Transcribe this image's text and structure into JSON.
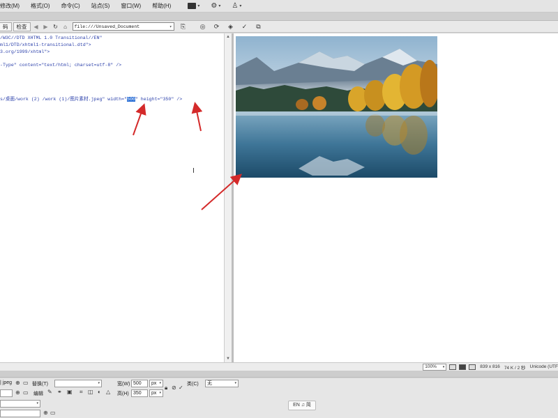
{
  "menubar": {
    "items": [
      "修改(M)",
      "格式(O)",
      "命令(C)",
      "站点(S)",
      "窗口(W)",
      "帮助(H)"
    ],
    "tools": [
      {
        "icon": "layout-icon"
      },
      {
        "icon": "gear-icon"
      },
      {
        "icon": "user-icon"
      }
    ]
  },
  "doctoolbar": {
    "tab_code_partial": "码",
    "tab_inspect": "检查",
    "address": "file:///Unsaved_Document"
  },
  "code": {
    "line1": "/W3C//DTD XHTML 1.0 Transitional//EN\"",
    "line2": "ml1/DTD/xhtml1-transitional.dtd\">",
    "line3": "3.org/1999/xhtml\">",
    "line4": "-Type\" content=\"text/html; charset=utf-8\" />",
    "line5_pre": "s/桌面/work (2) /work (1)/图片素材.jpeg\" width=\"",
    "line5_width": "500",
    "line5_mid": "\" height=\"",
    "line5_height": "350",
    "line5_post": "\" />"
  },
  "statusbar": {
    "zoom": "100%",
    "dimensions": "839 x 816",
    "size_info": "74 K / 2 秒",
    "encoding": "Unicode (UTF"
  },
  "properties": {
    "file_type": "jpeg",
    "replace_label": "替换(T)",
    "edit_label": "编辑",
    "width_label": "宽(W)",
    "width_value": "500",
    "height_label": "高(H)",
    "height_value": "350",
    "unit": "px",
    "class_label": "类(C)",
    "class_value": "无"
  },
  "ime": {
    "label": "EN ♫ 简"
  },
  "colors": {
    "selection": "#2a6fd6",
    "code_text": "#2a3faa",
    "arrow": "#d42a2a"
  }
}
